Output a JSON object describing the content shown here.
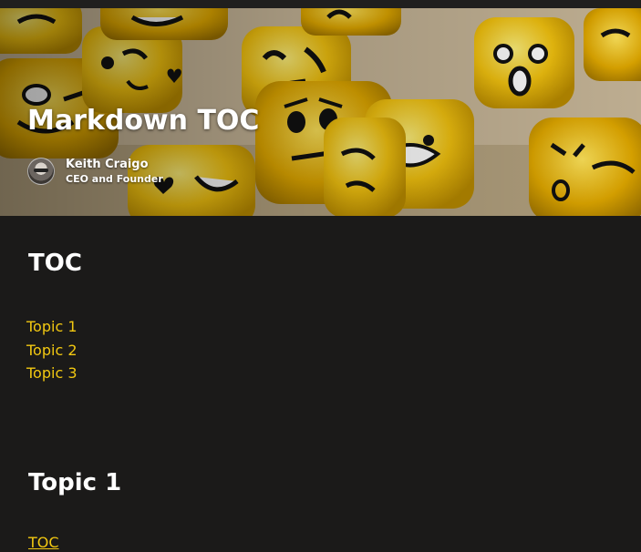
{
  "hero": {
    "title": "Markdown TOC",
    "image_icon": "emoji-dice-photo",
    "author": {
      "name": "Keith Craigo",
      "role": "CEO and Founder",
      "avatar_icon": "avatar"
    }
  },
  "toc": {
    "heading": "TOC",
    "links": [
      "Topic 1",
      "Topic 2",
      "Topic 3"
    ]
  },
  "sections": [
    {
      "heading": "Topic 1",
      "back_link": "TOC"
    }
  ],
  "colors": {
    "background": "#1b1a19",
    "link": "#f2c811",
    "text": "#ffffff",
    "dice": "#f5c518"
  }
}
